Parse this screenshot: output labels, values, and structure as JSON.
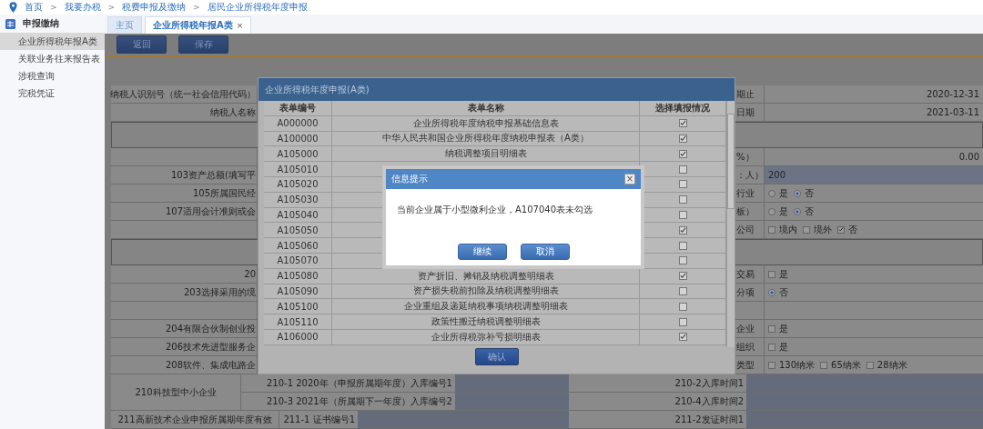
{
  "breadcrumb": {
    "separator": ">",
    "items": [
      "首页",
      "我要办税",
      "税费申报及缴纳",
      "居民企业所得税年度申报"
    ]
  },
  "sidebar": {
    "title": "申报缴纳",
    "items": [
      {
        "label": "企业所得税年报A类",
        "selected": true
      },
      {
        "label": "关联业务往来报告表",
        "selected": false
      },
      {
        "label": "涉税查询",
        "selected": false
      },
      {
        "label": "完税凭证",
        "selected": false
      }
    ]
  },
  "tabs": [
    {
      "label": "主页",
      "selected": false
    },
    {
      "label": "企业所得税年报A类",
      "selected": true,
      "close": "×"
    }
  ],
  "toolbar": [
    "返回",
    "保存"
  ],
  "form": {
    "rows": [
      {
        "kind": "text",
        "label": "纳税人识别号（统一社会信用代码）",
        "right_label": "期止",
        "value": "2020-12-31"
      },
      {
        "kind": "text",
        "label": "纳税人名称",
        "right_label": "日期",
        "value": "2021-03-11"
      },
      {
        "kind": "section"
      },
      {
        "kind": "text",
        "right_label": "%）",
        "value": "0.00"
      },
      {
        "kind": "input",
        "label": "103资产总额(填写平",
        "right_label": "：人）",
        "value": "200"
      },
      {
        "kind": "radio",
        "label": "105所属国民经",
        "right_label": "行业",
        "options": [
          {
            "label": "是",
            "selected": false
          },
          {
            "label": "否",
            "selected": true
          }
        ]
      },
      {
        "kind": "radio",
        "label": "107适用会计准则或会",
        "right_label": "板）",
        "options": [
          {
            "label": "是",
            "selected": false
          },
          {
            "label": "否",
            "selected": true
          }
        ]
      },
      {
        "kind": "check",
        "right_label": "公司",
        "options": [
          {
            "label": "境内",
            "checked": false
          },
          {
            "label": "境外",
            "checked": false
          },
          {
            "label": "否",
            "checked": true
          }
        ]
      },
      {
        "kind": "section"
      },
      {
        "kind": "check",
        "label": "20",
        "right_label": "交易",
        "options": [
          {
            "label": "是",
            "checked": false
          }
        ]
      },
      {
        "kind": "radio",
        "label": "203选择采用的境",
        "right_label": "分项",
        "options": [
          {
            "label": "否",
            "selected": true
          }
        ]
      },
      {
        "kind": "blank"
      },
      {
        "kind": "check",
        "label": "204有限合伙制创业投",
        "right_label": "企业",
        "options": [
          {
            "label": "是",
            "checked": false
          }
        ]
      },
      {
        "kind": "check",
        "label": "206技术先进型服务企",
        "right_label": "组织",
        "options": [
          {
            "label": "是",
            "checked": false
          }
        ]
      },
      {
        "kind": "check",
        "label": "208软件、集成电路企",
        "right_label": "类型",
        "options": [
          {
            "label": "130纳米",
            "checked": false
          },
          {
            "label": "65纳米",
            "checked": false
          },
          {
            "label": "28纳米",
            "checked": false
          }
        ]
      }
    ],
    "groups": [
      {
        "kind": "wide",
        "label": "210科技型中小企业",
        "lines": [
          {
            "left": "210-1 2020年（申报所属期年度）入库编号1",
            "right": "210-2入库时间1"
          },
          {
            "left": "210-3 2021年（所属期下一年度）入库编号2",
            "right": "210-4入库时间2"
          }
        ]
      },
      {
        "kind": "narrow",
        "label": "211高新技术企业申报所属期年度有效",
        "lines": [
          {
            "left": "211-1 证书编号1",
            "right": "211-2发证时间1"
          }
        ]
      }
    ]
  },
  "dialog": {
    "title": "企业所得税年度申报(A类)",
    "columns": [
      "表单编号",
      "表单名称",
      "选择填报情况"
    ],
    "rows": [
      {
        "code": "A000000",
        "name": "企业所得税年度纳税申报基础信息表",
        "checked": true
      },
      {
        "code": "A100000",
        "name": "中华人民共和国企业所得税年度纳税申报表（A类）",
        "checked": true
      },
      {
        "code": "A105000",
        "name": "纳税调整项目明细表",
        "checked": true
      },
      {
        "code": "A105010",
        "checked": false
      },
      {
        "code": "A105020",
        "checked": false
      },
      {
        "code": "A105030",
        "checked": false
      },
      {
        "code": "A105040",
        "checked": false
      },
      {
        "code": "A105050",
        "checked": true
      },
      {
        "code": "A105060",
        "checked": false
      },
      {
        "code": "A105070",
        "checked": false
      },
      {
        "code": "A105080",
        "name": "资产折旧、摊销及纳税调整明细表",
        "checked": true
      },
      {
        "code": "A105090",
        "name": "资产损失税前扣除及纳税调整明细表",
        "checked": false
      },
      {
        "code": "A105100",
        "name": "企业重组及递延纳税事项纳税调整明细表",
        "checked": false
      },
      {
        "code": "A105110",
        "name": "政策性搬迁纳税调整明细表",
        "checked": false
      },
      {
        "code": "A106000",
        "name": "企业所得税弥补亏损明细表",
        "checked": true
      }
    ],
    "confirm": "确认"
  },
  "alert": {
    "title": "信息提示",
    "close": "×",
    "message": "当前企业属于小型微利企业，A107040表未勾选",
    "buttons": [
      "继续",
      "取消"
    ]
  }
}
